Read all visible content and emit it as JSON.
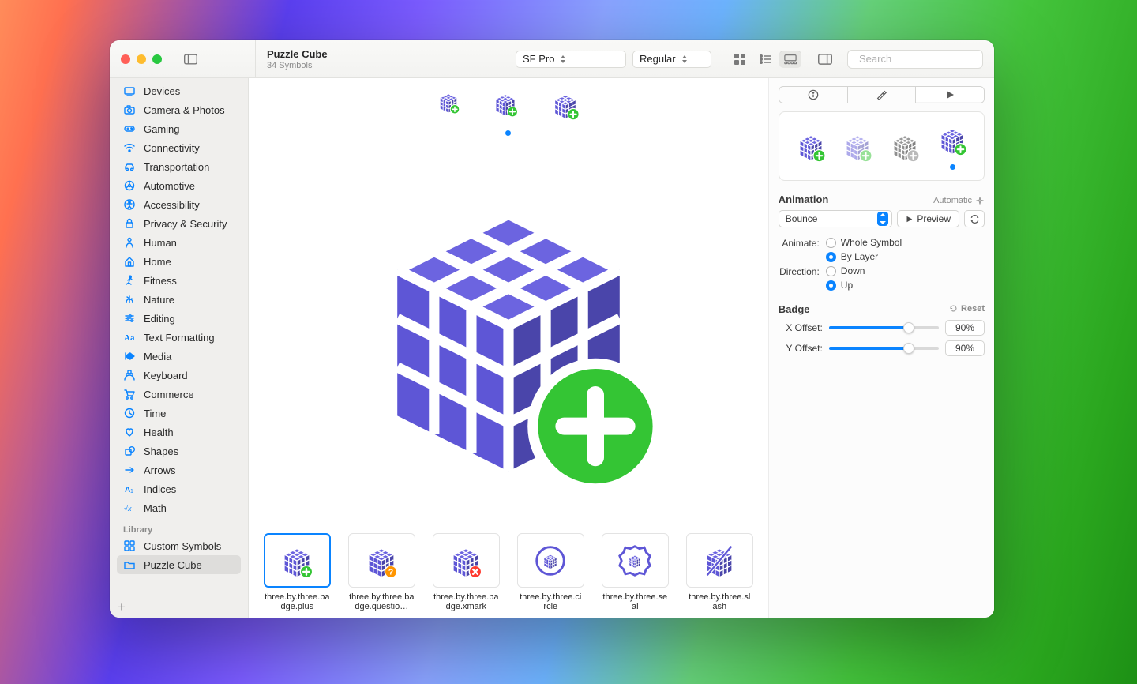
{
  "header": {
    "title": "Puzzle Cube",
    "subtitle": "34 Symbols",
    "font_select": "SF Pro",
    "weight_select": "Regular",
    "search_placeholder": "Search"
  },
  "sidebar": {
    "library_header": "Library",
    "categories": [
      "Devices",
      "Camera & Photos",
      "Gaming",
      "Connectivity",
      "Transportation",
      "Automotive",
      "Accessibility",
      "Privacy & Security",
      "Human",
      "Home",
      "Fitness",
      "Nature",
      "Editing",
      "Text Formatting",
      "Media",
      "Keyboard",
      "Commerce",
      "Time",
      "Health",
      "Shapes",
      "Arrows",
      "Indices",
      "Math"
    ],
    "library_items": [
      "Custom Symbols",
      "Puzzle Cube"
    ]
  },
  "thumbnails": [
    {
      "label": "three.by.three.badge.plus",
      "badge": "plus"
    },
    {
      "label": "three.by.three.badge.questio…",
      "badge": "question"
    },
    {
      "label": "three.by.three.badge.xmark",
      "badge": "xmark"
    },
    {
      "label": "three.by.three.circle",
      "badge": "circle"
    },
    {
      "label": "three.by.three.seal",
      "badge": "seal"
    },
    {
      "label": "three.by.three.slash",
      "badge": "slash"
    }
  ],
  "inspector": {
    "animation_header": "Animation",
    "animation_mode": "Automatic",
    "animation_type": "Bounce",
    "preview_label": "Preview",
    "animate_label": "Animate:",
    "animate_options": [
      "Whole Symbol",
      "By Layer"
    ],
    "animate_selected": 1,
    "direction_label": "Direction:",
    "direction_options": [
      "Down",
      "Up"
    ],
    "direction_selected": 1,
    "badge_header": "Badge",
    "reset_label": "Reset",
    "xoffset_label": "X Offset:",
    "yoffset_label": "Y Offset:",
    "xoffset_value": "90%",
    "yoffset_value": "90%",
    "xoffset_pct": 73,
    "yoffset_pct": 73
  },
  "colors": {
    "accent": "#5e56d6",
    "badge_green": "#34c534",
    "badge_orange": "#ff9500",
    "badge_red": "#ff3b30",
    "system_blue": "#0a84ff"
  }
}
